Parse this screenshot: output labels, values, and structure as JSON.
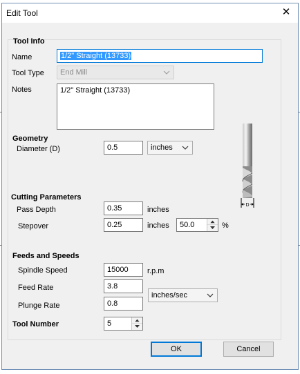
{
  "window": {
    "title": "Edit Tool",
    "close_glyph": "✕"
  },
  "tool_info": {
    "title": "Tool Info",
    "name_label": "Name",
    "name_value": "1/2\" Straight (13733)",
    "type_label": "Tool Type",
    "type_value": "End Mill",
    "notes_label": "Notes",
    "notes_value": "1/2\" Straight (13733)"
  },
  "geometry": {
    "title": "Geometry",
    "diameter_label": "Diameter (D)",
    "diameter_value": "0.5",
    "units_value": "inches",
    "diagram_label": "D"
  },
  "cutting": {
    "title": "Cutting Parameters",
    "pass_depth_label": "Pass Depth",
    "pass_depth_value": "0.35",
    "pass_depth_units": "inches",
    "stepover_label": "Stepover",
    "stepover_value": "0.25",
    "stepover_units": "inches",
    "stepover_percent_value": "50.0",
    "percent_sign": "%"
  },
  "feeds": {
    "title": "Feeds and Speeds",
    "spindle_label": "Spindle Speed",
    "spindle_value": "15000",
    "spindle_units": "r.p.m",
    "feed_label": "Feed Rate",
    "feed_value": "3.8",
    "plunge_label": "Plunge Rate",
    "plunge_value": "0.8",
    "rate_units_value": "inches/sec"
  },
  "tool_number": {
    "label": "Tool Number",
    "value": "5"
  },
  "buttons": {
    "ok": "OK",
    "cancel": "Cancel"
  },
  "icons": {
    "close": "close-icon",
    "dropdown": "chevron-down-icon",
    "spin_up": "spin-up-icon",
    "spin_down": "spin-down-icon",
    "tool_image": "end-mill-bit-icon"
  },
  "colors": {
    "accent": "#0078d7",
    "selection": "#3399ff",
    "dialog_bg": "#f0f0f0"
  }
}
